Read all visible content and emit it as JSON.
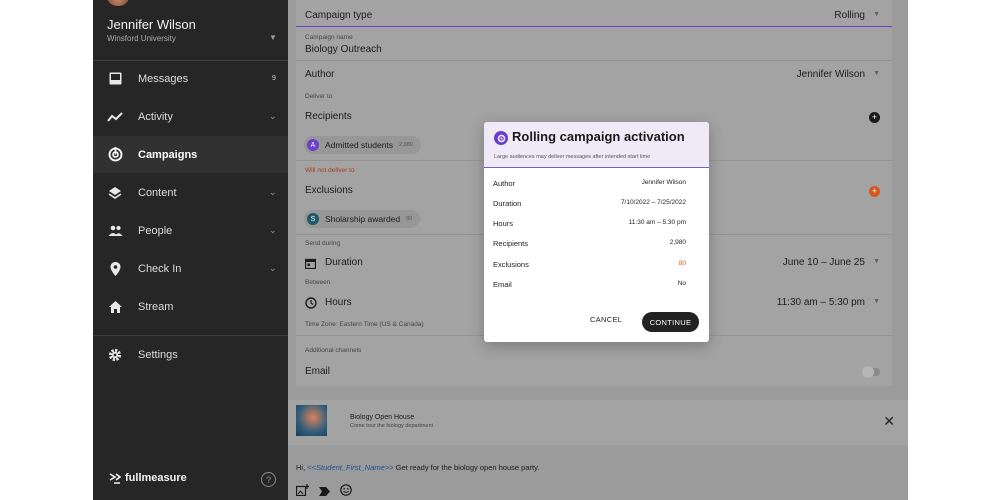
{
  "user": {
    "name": "Jennifer Wilson",
    "org": "Winsford University"
  },
  "nav": [
    {
      "label": "Messages",
      "badge": "9",
      "icon": "inbox-icon"
    },
    {
      "label": "Activity",
      "icon": "activity-icon"
    },
    {
      "label": "Campaigns",
      "icon": "campaigns-icon",
      "active": true
    },
    {
      "label": "Content",
      "icon": "layers-icon"
    },
    {
      "label": "People",
      "icon": "people-icon"
    },
    {
      "label": "Check In",
      "icon": "location-pin-icon"
    },
    {
      "label": "Stream",
      "icon": "home-icon"
    },
    {
      "label": "Settings",
      "icon": "gear-icon"
    }
  ],
  "brand": {
    "logo_text": "fullmeasure"
  },
  "form": {
    "campaign_type_label": "Campaign type",
    "campaign_type_value": "Rolling",
    "campaign_name_label": "Campaign name",
    "campaign_name_value": "Biology Outreach",
    "author_label": "Author",
    "author_value": "Jennifer Wilson",
    "deliver_to_label": "Deliver to",
    "recipients_label": "Recipients",
    "recipient_chip": {
      "initial": "A",
      "label": "Admitted students",
      "count": "2,980"
    },
    "not_deliver_label": "Will not deliver to",
    "exclusions_label": "Exclusions",
    "exclusion_chip": {
      "initial": "S",
      "label": "Sholarship awarded",
      "count": "80"
    },
    "send_during_label": "Send during",
    "duration_label": "Duration",
    "duration_value": "June 10 – June 25",
    "between_label": "Between",
    "hours_label": "Hours",
    "hours_value": "11:30 am – 5:30 pm",
    "timezone_text": "Time Zone: Eastern Time (US & Canada)",
    "additional_label": "Additional channels",
    "email_label": "Email"
  },
  "preview": {
    "title": "Biology Open House",
    "subtitle": "Come tour the biology department"
  },
  "message": {
    "prefix": "Hi, ",
    "token": "<<Student_First_Name>>",
    "suffix": " Get ready for the biology open house party."
  },
  "modal": {
    "title": "Rolling campaign activation",
    "subtitle": "Large audiences may deliver messages after intended start time",
    "rows": [
      {
        "label": "Author",
        "value": "Jennifer Wilson"
      },
      {
        "label": "Duration",
        "value": "7/10/2022 – 7/25/2022"
      },
      {
        "label": "Hours",
        "value": "11:30 am – 5:30 pm"
      },
      {
        "label": "Recipients",
        "value": "2,980"
      },
      {
        "label": "Exclusions",
        "value": "80"
      },
      {
        "label": "Email",
        "value": "No"
      }
    ],
    "cancel": "CANCEL",
    "continue": "CONTINUE"
  },
  "colors": {
    "accent": "#6a3fd0",
    "warning": "#d9541e",
    "dark": "#262626"
  }
}
